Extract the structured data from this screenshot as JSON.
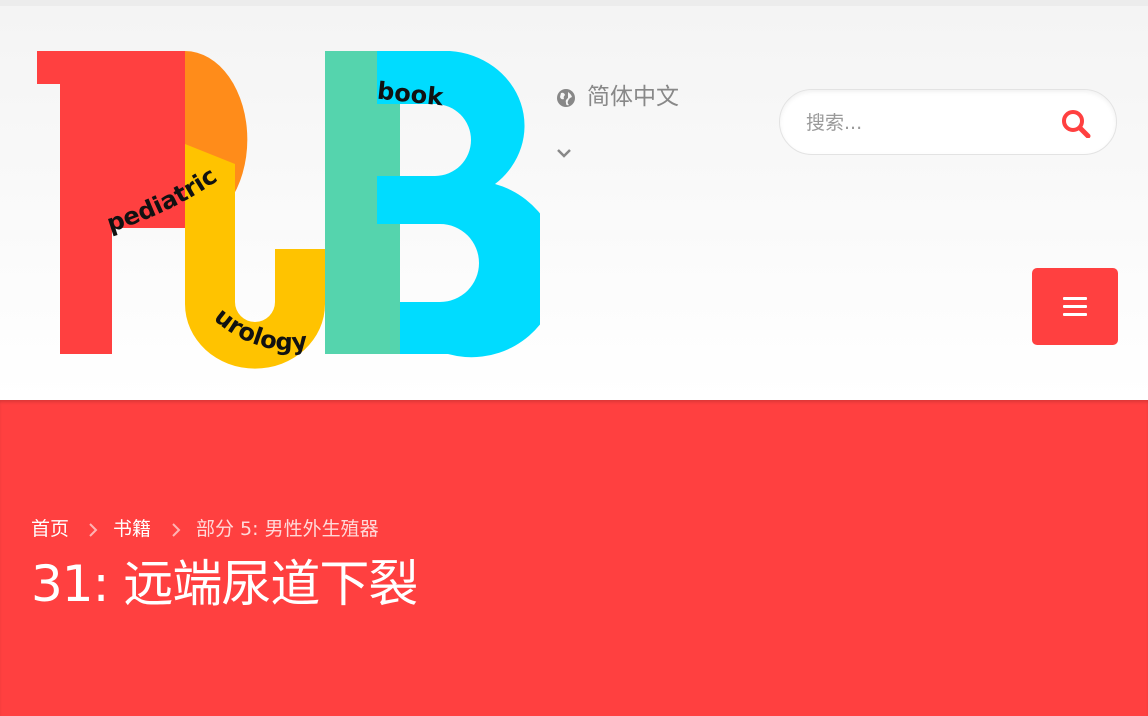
{
  "logo": {
    "word_book": "book",
    "word_pediatric": "pediatric",
    "word_urology": "urology",
    "colors": {
      "red": "#ff4040",
      "orange": "#ff8c1a",
      "yellow": "#ffc300",
      "green": "#55d4ad",
      "cyan": "#00dcff"
    }
  },
  "language": {
    "label": "简体中文",
    "icon": "globe-icon",
    "dropdown_icon": "chevron-down-icon"
  },
  "search": {
    "placeholder": "搜索...",
    "icon": "search-icon"
  },
  "menu": {
    "icon": "hamburger-icon",
    "color": "#ff4040"
  },
  "breadcrumb": {
    "items": [
      "首页",
      "书籍"
    ],
    "current": "部分 5: 男性外生殖器",
    "separator_icon": "chevron-right-icon"
  },
  "page": {
    "title": "31: 远端尿道下裂",
    "hero_color": "#ff4040"
  }
}
